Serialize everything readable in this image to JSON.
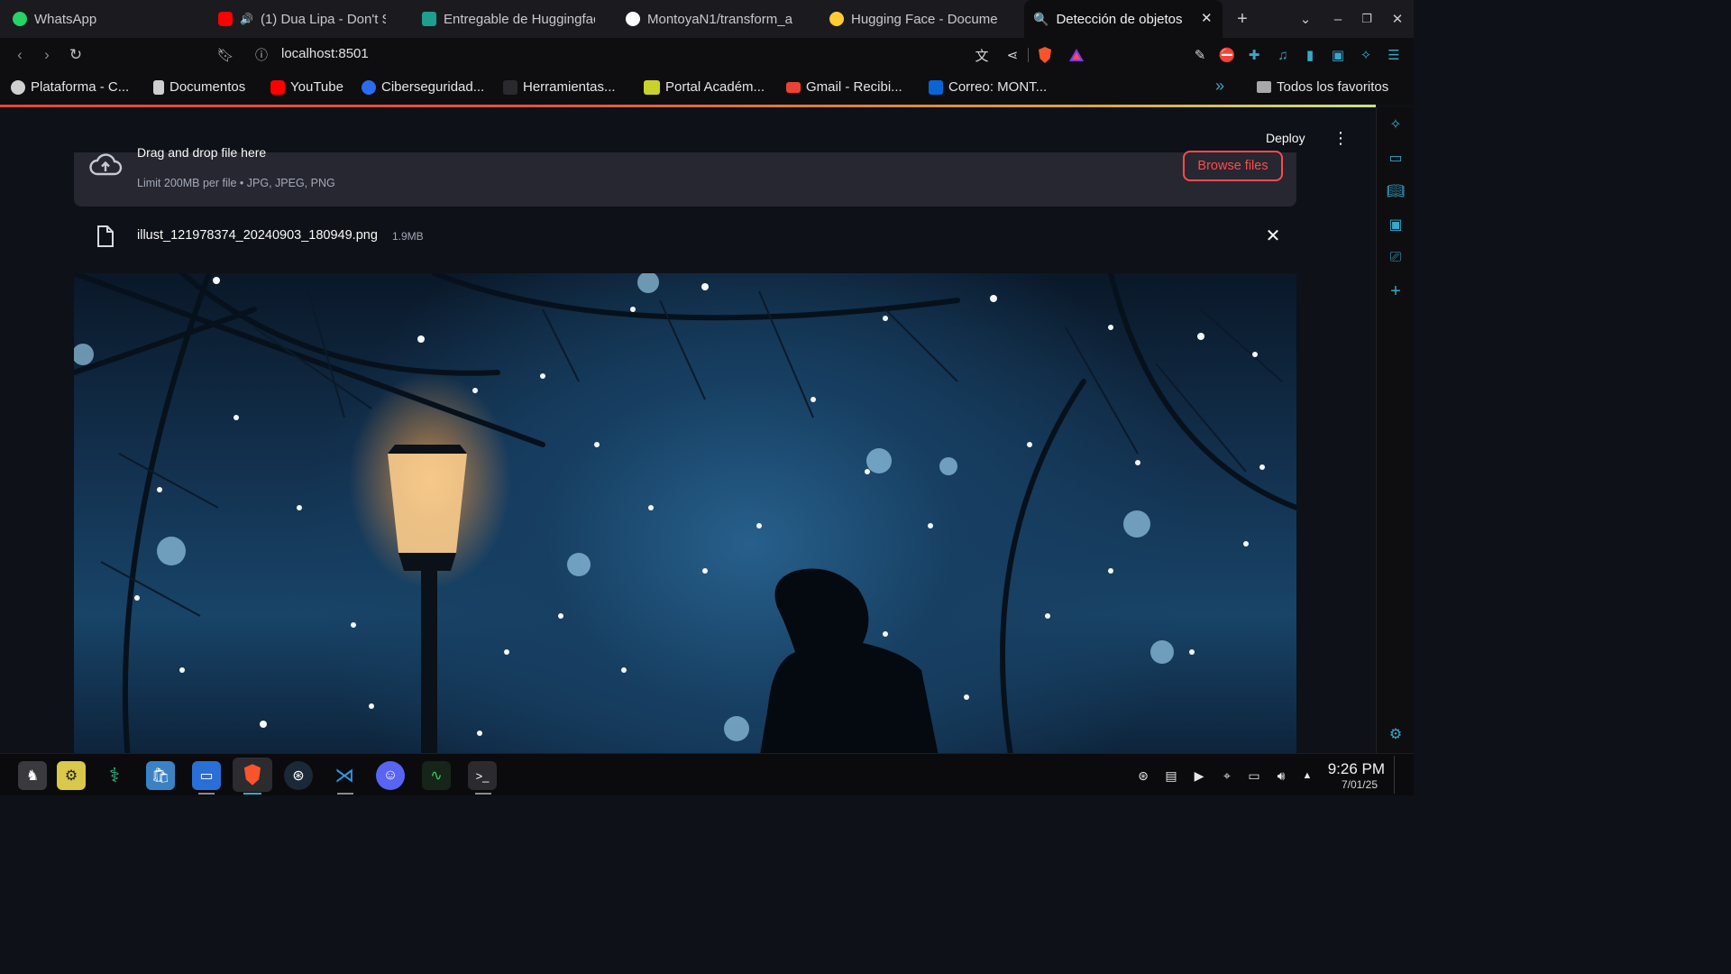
{
  "browser": {
    "tabs": [
      {
        "label": "WhatsApp",
        "icon": "whatsapp-icon",
        "color": "#25d366"
      },
      {
        "label": "(1) Dua Lipa - Don't St",
        "icon": "youtube-icon",
        "color": "#ff0000",
        "audio": "🔊"
      },
      {
        "label": "Entregable de Huggingfac",
        "icon": "classroom-icon",
        "color": "#1e9e8f"
      },
      {
        "label": "MontoyaN1/transform_a",
        "icon": "github-icon",
        "color": "#ffffff"
      },
      {
        "label": "Hugging Face - Docume",
        "icon": "huggingface-icon",
        "color": "#ffcc33"
      },
      {
        "label": "Detección de objetos",
        "icon": "magnifier-icon",
        "color": "#7fb3d9"
      }
    ],
    "new_tab": "+",
    "url": "localhost:8501",
    "bookmarks": [
      {
        "label": "Plataforma - C...",
        "icon": "globe-icon",
        "color": "#e0e0e0"
      },
      {
        "label": "Documentos",
        "icon": "document-icon",
        "color": "#e0e0e0"
      },
      {
        "label": "YouTube",
        "icon": "youtube-icon",
        "color": "#ff0000"
      },
      {
        "label": "Ciberseguridad...",
        "icon": "c-logo-icon",
        "color": "#2c6bed"
      },
      {
        "label": "Herramientas...",
        "icon": "tools-icon",
        "color": "#444"
      },
      {
        "label": "Portal Académ...",
        "icon": "uts-logo-icon",
        "color": "#c9d12a"
      },
      {
        "label": "Gmail - Recibi...",
        "icon": "gmail-icon",
        "color": "#ea4335"
      },
      {
        "label": "Correo: MONT...",
        "icon": "outlook-icon",
        "color": "#0a64d4"
      }
    ],
    "bookmarks_overflow": "»",
    "all_bookmarks": "Todos los favoritos"
  },
  "app": {
    "deploy_label": "Deploy",
    "uploader": {
      "title": "Drag and drop file here",
      "limit": "Limit 200MB per file • JPG, JPEG, PNG",
      "browse_label": "Browse files"
    },
    "file": {
      "name": "illust_121978374_20240903_180949.png",
      "size": "1.9MB"
    }
  },
  "taskbar": {
    "time": "9:26 PM",
    "date": "7/01/25"
  },
  "colors": {
    "accent": "#ff4b4b",
    "app_bg": "#0e1117",
    "dropzone_bg": "#262730"
  }
}
